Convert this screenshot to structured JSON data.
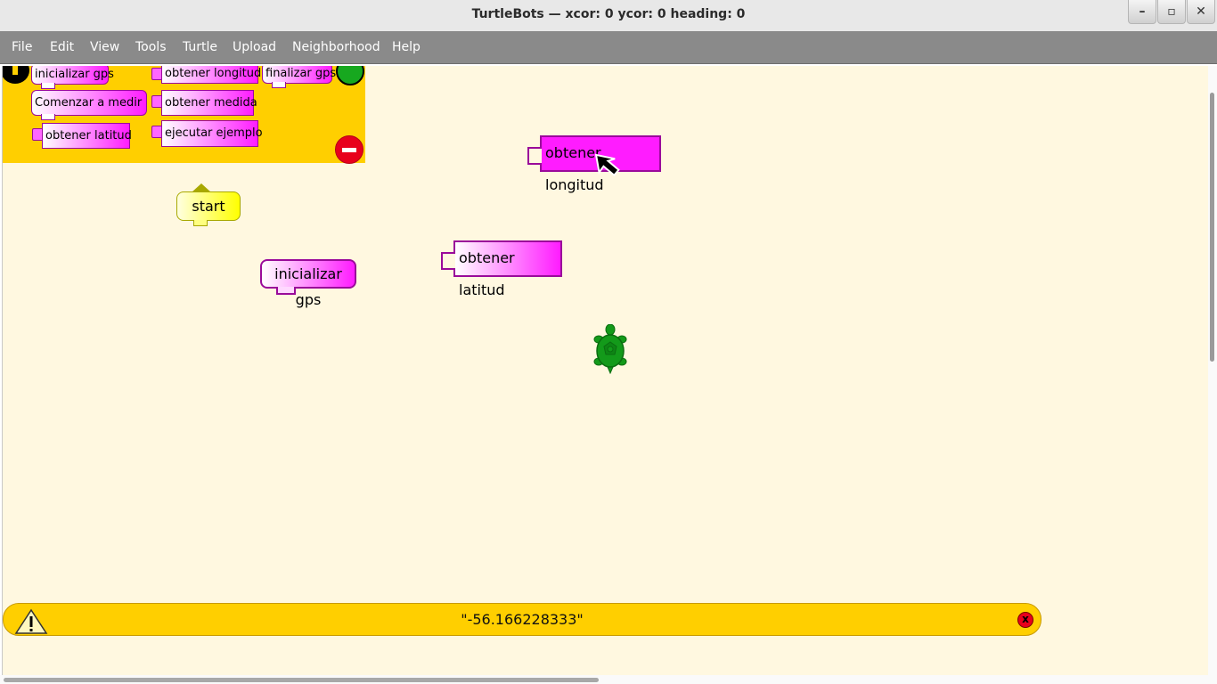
{
  "window": {
    "title": "TurtleBots — xcor: 0 ycor: 0 heading: 0",
    "controls": [
      "–",
      "▫",
      "✕"
    ]
  },
  "menu": {
    "items": [
      "File",
      "Edit",
      "View",
      "Tools",
      "Turtle",
      "Upload",
      "Neighborhood",
      "Help"
    ]
  },
  "palette": {
    "blocks": {
      "inicializar": "inicializar gps",
      "comenzar": "Comenzar a medir",
      "latitud": "obtener latitud",
      "longitud": "obtener longitud",
      "medida": "obtener medida",
      "ejemplo": "ejecutar ejemplo",
      "finalizar": "finalizar gps"
    }
  },
  "canvas": {
    "start_label": "start",
    "inicializar_label": "inicializar gps",
    "latitud_label": "obtener latitud",
    "longitud_label": "obtener longitud"
  },
  "status": {
    "message": "\"-56.166228333\"",
    "close_label": "x"
  },
  "colors": {
    "palette_bg": "#ffcf00",
    "canvas_bg": "#fff8e0",
    "block_magenta": "#ff1cff",
    "turtle_green": "#139a1a"
  }
}
